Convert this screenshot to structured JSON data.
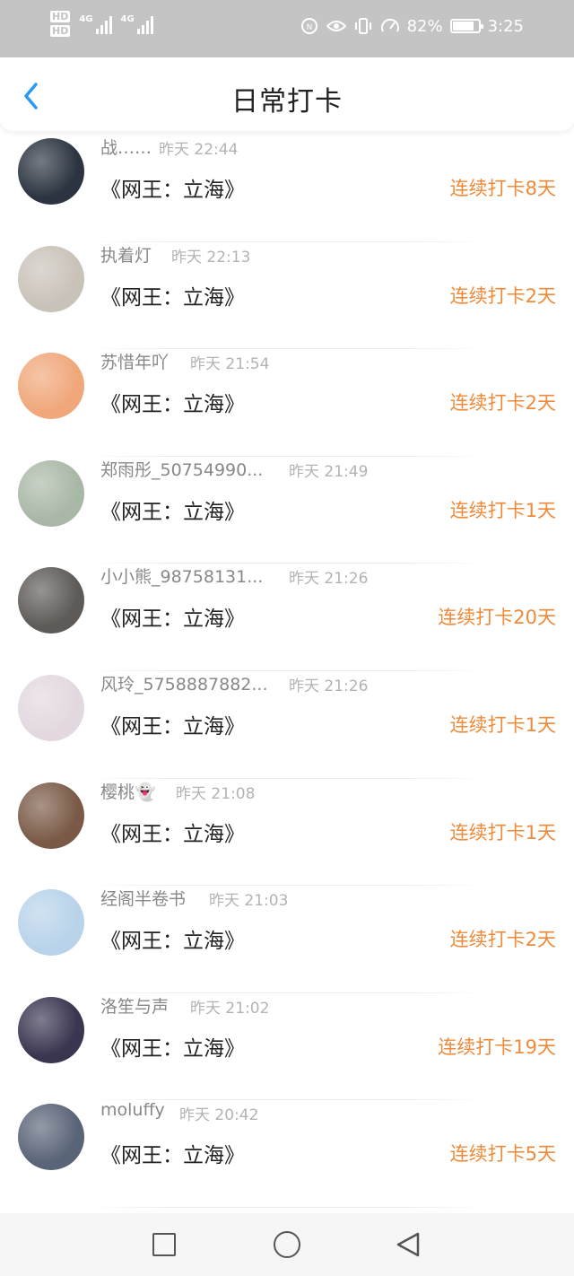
{
  "status_bar": {
    "hd1": "HD",
    "hd2": "HD",
    "net1": "4G",
    "net2": "4G",
    "battery_text": "82%",
    "battery_level": 0.82,
    "time": "3:25"
  },
  "header": {
    "title": "日常打卡"
  },
  "entries": [
    {
      "name": "战……",
      "time": "昨天 22:44",
      "book": "《网王：立海》",
      "streak": "连续打卡8天",
      "avatar_color": "#2b3440"
    },
    {
      "name": "执着灯",
      "time": "昨天 22:13",
      "book": "《网王：立海》",
      "streak": "连续打卡2天",
      "avatar_color": "#c9c2b8"
    },
    {
      "name": "苏惜年吖",
      "time": "昨天 21:54",
      "book": "《网王：立海》",
      "streak": "连续打卡2天",
      "avatar_color": "#f0a77a"
    },
    {
      "name": "郑雨彤_50754990...",
      "time": "昨天 21:49",
      "book": "《网王：立海》",
      "streak": "连续打卡1天",
      "avatar_color": "#a9b8a6"
    },
    {
      "name": "小小熊_98758131...",
      "time": "昨天 21:26",
      "book": "《网王：立海》",
      "streak": "连续打卡20天",
      "avatar_color": "#5e5a57"
    },
    {
      "name": "风玲_5758887882...",
      "time": "昨天 21:26",
      "book": "《网王：立海》",
      "streak": "连续打卡1天",
      "avatar_color": "#e3d8e0"
    },
    {
      "name": "樱桃👻",
      "time": "昨天 21:08",
      "book": "《网王：立海》",
      "streak": "连续打卡1天",
      "avatar_color": "#7a5a47"
    },
    {
      "name": "经阁半卷书",
      "time": "昨天 21:03",
      "book": "《网王：立海》",
      "streak": "连续打卡2天",
      "avatar_color": "#b8d3ea"
    },
    {
      "name": "洛笙与声",
      "time": "昨天 21:02",
      "book": "《网王：立海》",
      "streak": "连续打卡19天",
      "avatar_color": "#3a3550"
    },
    {
      "name": "moluffy",
      "time": "昨天 20:42",
      "book": "《网王：立海》",
      "streak": "连续打卡5天",
      "avatar_color": "#5a6478"
    }
  ],
  "colors": {
    "accent": "#ee8a3a",
    "back": "#2a9af0",
    "status_bar_bg": "#c4c4c4"
  },
  "icons": {
    "back": "chevron-left-icon",
    "nav_recent": "square-icon",
    "nav_home": "circle-icon",
    "nav_back": "triangle-back-icon"
  }
}
